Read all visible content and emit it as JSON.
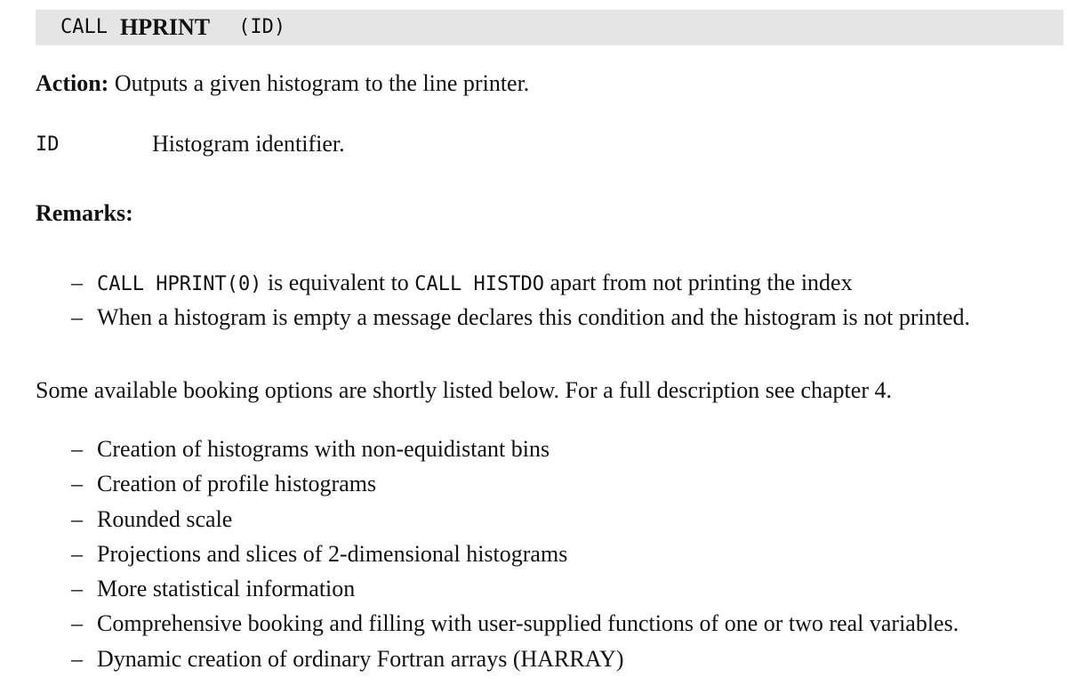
{
  "header": {
    "call_keyword": "CALL",
    "routine_name": "HPRINT",
    "arguments": "(ID)"
  },
  "action": {
    "label": "Action:",
    "text": "Outputs a given histogram to the line printer."
  },
  "parameters": [
    {
      "name": "ID",
      "description": "Histogram identifier."
    }
  ],
  "remarks": {
    "heading": "Remarks:",
    "items": [
      {
        "code1": "CALL HPRINT(0)",
        "text1": " is equivalent to ",
        "code2": "CALL HISTDO",
        "text2": " apart from not printing the index"
      },
      {
        "text": "When a histogram is empty a message declares this condition and the histogram is not printed."
      }
    ]
  },
  "booking_intro": "Some available booking options are shortly listed below. For a full description see chapter 4.",
  "booking_options": [
    "Creation of histograms with non-equidistant bins",
    "Creation of profile histograms",
    "Rounded scale",
    "Projections and slices of 2-dimensional histograms",
    "More statistical information",
    "Comprehensive booking and filling with user-supplied functions of one or two real variables.",
    "Dynamic creation of ordinary Fortran arrays (HARRAY)"
  ],
  "list_marker": "–"
}
